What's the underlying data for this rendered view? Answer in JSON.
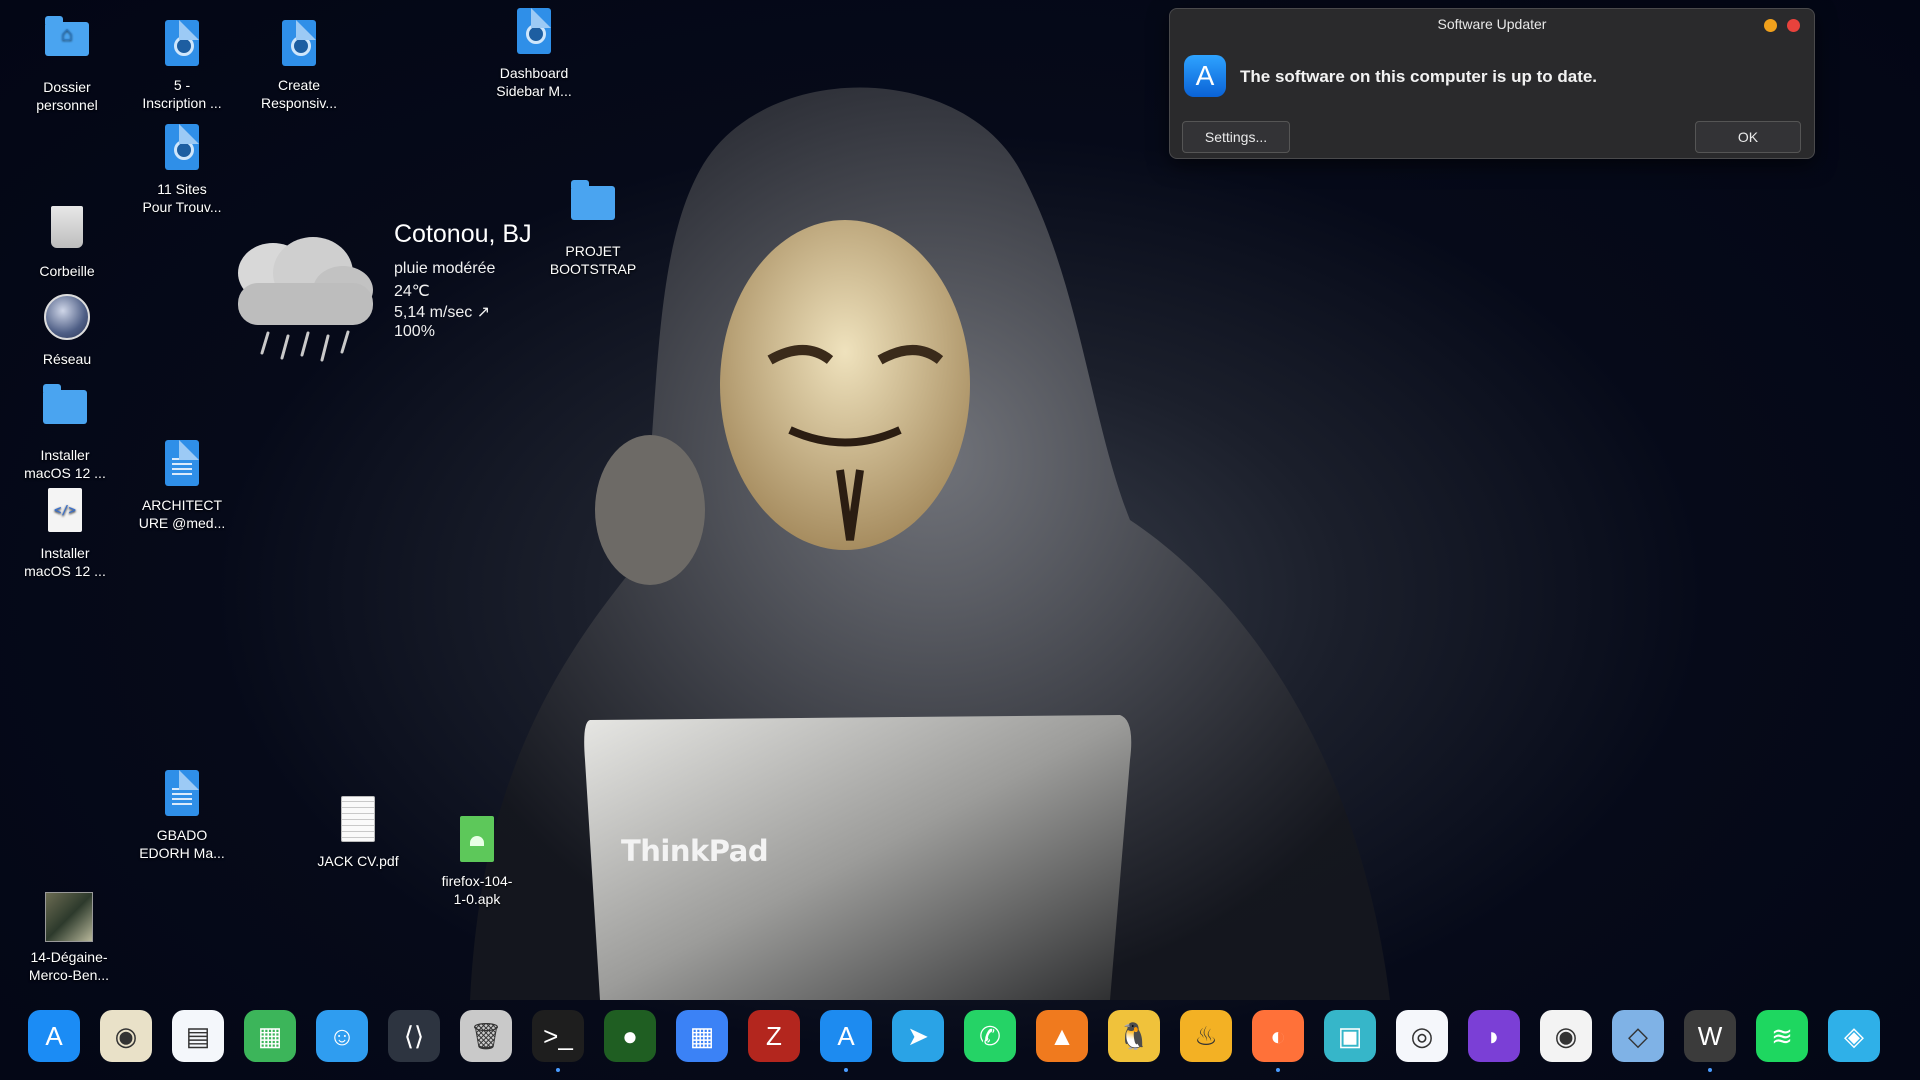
{
  "desktop": {
    "icons": [
      {
        "label": "Dossier\npersonnel"
      },
      {
        "label": "5 -\nInscription ..."
      },
      {
        "label": "Create\nResponsiv..."
      },
      {
        "label": "Dashboard\nSidebar M..."
      },
      {
        "label": "11 Sites\nPour Trouv..."
      },
      {
        "label": "Corbeille"
      },
      {
        "label": "PROJET\nBOOTSTRAP"
      },
      {
        "label": "Réseau"
      },
      {
        "label": "Installer\nmacOS 12 ..."
      },
      {
        "label": "ARCHITECT\nURE @med..."
      },
      {
        "label": "Installer\nmacOS 12 ..."
      },
      {
        "label": "GBADO\nEDORH Ma..."
      },
      {
        "label": "JACK CV.pdf"
      },
      {
        "label": "firefox-104-\n1-0.apk"
      },
      {
        "label": "14-Dégaine-\nMerco-Ben..."
      }
    ]
  },
  "wallpaper": {
    "brand": "ThinkPad"
  },
  "weather": {
    "city": "Cotonou, BJ",
    "condition": "pluie modérée",
    "temperature": "24℃",
    "wind": "5,14 m/sec ↗",
    "humidity": "100%"
  },
  "dialog": {
    "title": "Software Updater",
    "message": "The software on this computer is up to date.",
    "settings_label": "Settings...",
    "ok_label": "OK"
  },
  "dock": {
    "items": [
      {
        "name": "app-store",
        "glyph": "A",
        "color": "#1b8cf5"
      },
      {
        "name": "speaker",
        "glyph": "◉",
        "color": "#e9e1c8"
      },
      {
        "name": "text-editor",
        "glyph": "▤",
        "color": "#f4f7fb"
      },
      {
        "name": "spreadsheet",
        "glyph": "▦",
        "color": "#3cb55a"
      },
      {
        "name": "finder",
        "glyph": "☺",
        "color": "#2f9df0"
      },
      {
        "name": "vscode",
        "glyph": "⟨⟩",
        "color": "#2d3440"
      },
      {
        "name": "trash",
        "glyph": "🗑",
        "color": "#c9c9c9"
      },
      {
        "name": "terminal",
        "glyph": ">_",
        "color": "#1e1e1e"
      },
      {
        "name": "green-orb",
        "glyph": "●",
        "color": "#1f5e22"
      },
      {
        "name": "launchpad",
        "glyph": "▦",
        "color": "#3b82f6"
      },
      {
        "name": "filezilla",
        "glyph": "Z",
        "color": "#b3261e"
      },
      {
        "name": "software-update",
        "glyph": "A",
        "color": "#1d8bf0"
      },
      {
        "name": "telegram",
        "glyph": "➤",
        "color": "#2aa3e6"
      },
      {
        "name": "whatsapp",
        "glyph": "✆",
        "color": "#25d366"
      },
      {
        "name": "vlc",
        "glyph": "▲",
        "color": "#f07a1e"
      },
      {
        "name": "tux",
        "glyph": "🐧",
        "color": "#f0c23b"
      },
      {
        "name": "genie",
        "glyph": "♨",
        "color": "#f3b124"
      },
      {
        "name": "firefox",
        "glyph": "◐",
        "color": "#ff7139"
      },
      {
        "name": "screenshot-tool",
        "glyph": "▣",
        "color": "#36b6c9"
      },
      {
        "name": "camera",
        "glyph": "◎",
        "color": "#f5f7fb"
      },
      {
        "name": "podcast",
        "glyph": "◗",
        "color": "#7b3fd6"
      },
      {
        "name": "chrome",
        "glyph": "◉",
        "color": "#f3f3f3"
      },
      {
        "name": "virtualbox",
        "glyph": "◇",
        "color": "#7fb2e6"
      },
      {
        "name": "wine",
        "glyph": "W",
        "color": "#3b3b3b"
      },
      {
        "name": "spotify",
        "glyph": "≋",
        "color": "#1ed760"
      },
      {
        "name": "network-monitor",
        "glyph": "◈",
        "color": "#2fb0e8"
      }
    ]
  }
}
